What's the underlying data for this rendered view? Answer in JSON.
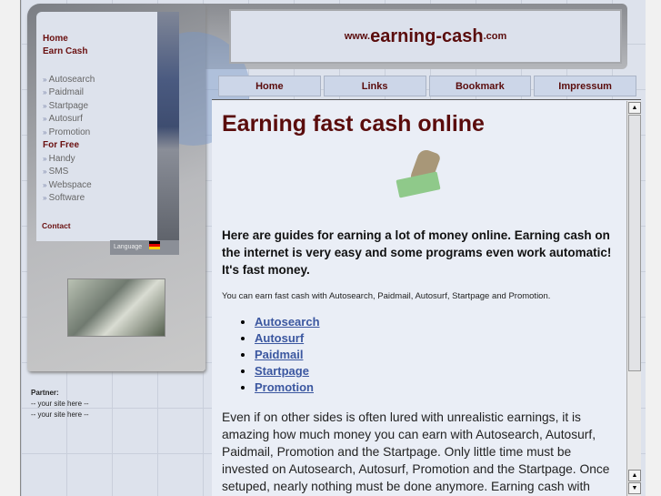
{
  "logo": {
    "prefix": "www.",
    "name": "earning-cash",
    "suffix": ".com"
  },
  "sidebar": {
    "home": "Home",
    "earn_cash": "Earn Cash",
    "earn_items": [
      "Autosearch",
      "Paidmail",
      "Startpage",
      "Autosurf",
      "Promotion"
    ],
    "for_free": "For Free",
    "free_items": [
      "Handy",
      "SMS",
      "Webspace",
      "Software"
    ],
    "contact": "Contact",
    "language": "Language"
  },
  "partner": {
    "title": "Partner:",
    "items": [
      "-- your site here --",
      "-- your site here --"
    ]
  },
  "tabs": [
    "Home",
    "Links",
    "Bookmark",
    "Impressum"
  ],
  "content": {
    "title": "Earning fast cash online",
    "lead": "Here are guides for earning a lot of money online. Earning cash on the internet is very easy and some programs even work automatic! It's fast money.",
    "small": "You can earn fast cash with Autosearch, Paidmail, Autosurf, Startpage and Promotion.",
    "links": [
      "Autosearch",
      "Autosurf",
      "Paidmail",
      "Startpage",
      "Promotion"
    ],
    "body": "Even if on other sides is often lured with unrealistic earnings, it is amazing how much money you can earn with Autosearch, Autosurf, Paidmail, Promotion and the Startpage. Only little time must be invested on Autosearch, Autosurf, Promotion and the Startpage. Once setuped, nearly nothing must be done anymore. Earning cash with Paidmail takes some"
  }
}
